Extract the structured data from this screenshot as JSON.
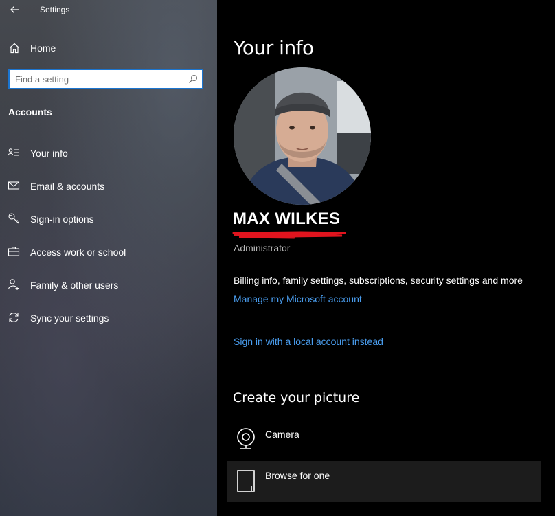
{
  "app": {
    "title": "Settings"
  },
  "sidebar": {
    "home_label": "Home",
    "search_placeholder": "Find a setting",
    "section": "Accounts",
    "items": [
      {
        "label": "Your info",
        "icon": "person-card-icon"
      },
      {
        "label": "Email & accounts",
        "icon": "mail-icon"
      },
      {
        "label": "Sign-in options",
        "icon": "key-icon"
      },
      {
        "label": "Access work or school",
        "icon": "briefcase-icon"
      },
      {
        "label": "Family & other users",
        "icon": "person-add-icon"
      },
      {
        "label": "Sync your settings",
        "icon": "sync-icon"
      }
    ]
  },
  "main": {
    "title": "Your info",
    "user_name": "MAX WILKES",
    "user_role": "Administrator",
    "billing_text": "Billing info, family settings, subscriptions, security settings and more",
    "manage_link": "Manage my Microsoft account",
    "local_link": "Sign in with a local account instead",
    "create_picture_title": "Create your picture",
    "picture_options": [
      {
        "label": "Camera",
        "icon": "camera-icon"
      },
      {
        "label": "Browse for one",
        "icon": "file-icon"
      }
    ]
  },
  "colors": {
    "accent": "#1b75d0",
    "link": "#4a9ef0",
    "redaction": "#e0141e"
  }
}
